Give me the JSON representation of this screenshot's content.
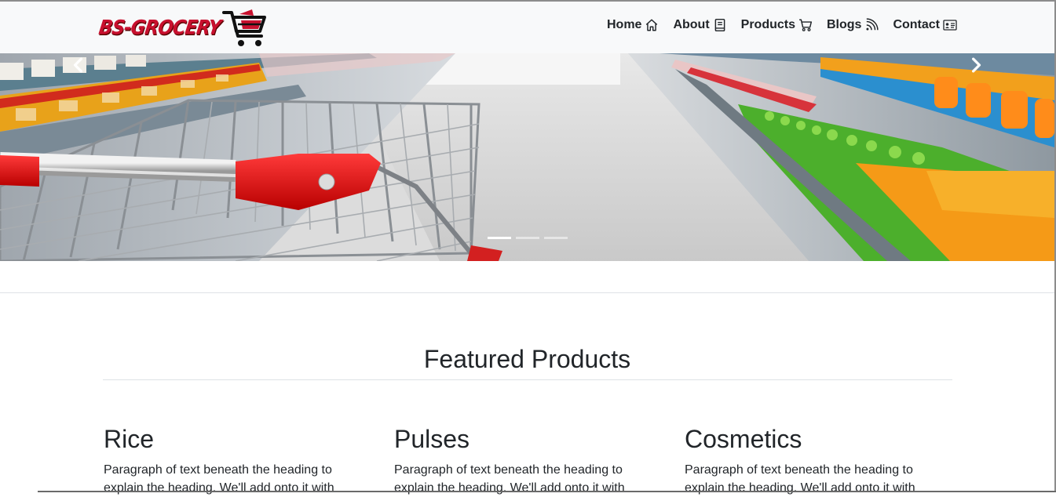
{
  "brand": {
    "name": "BS-GROCERY",
    "icon": "shopping-cart-logo-icon"
  },
  "nav": {
    "items": [
      {
        "label": "Home",
        "icon": "home-icon"
      },
      {
        "label": "About",
        "icon": "book-icon"
      },
      {
        "label": "Products",
        "icon": "cart-icon"
      },
      {
        "label": "Blogs",
        "icon": "rss-icon"
      },
      {
        "label": "Contact",
        "icon": "contact-card-icon"
      }
    ]
  },
  "carousel": {
    "active_slide": 1,
    "slide_count": 3,
    "prev_icon": "chevron-left-icon",
    "next_icon": "chevron-right-icon"
  },
  "featured": {
    "title": "Featured Products",
    "products": [
      {
        "name": "Rice",
        "description": "Paragraph of text beneath the heading to explain the heading. We'll add onto it with"
      },
      {
        "name": "Pulses",
        "description": "Paragraph of text beneath the heading to explain the heading. We'll add onto it with"
      },
      {
        "name": "Cosmetics",
        "description": "Paragraph of text beneath the heading to explain the heading. We'll add onto it with"
      }
    ]
  },
  "colors": {
    "brand_red": "#c8102e",
    "navbar_bg": "#f8f9fa",
    "text": "#212529",
    "divider": "#dee2e6"
  }
}
